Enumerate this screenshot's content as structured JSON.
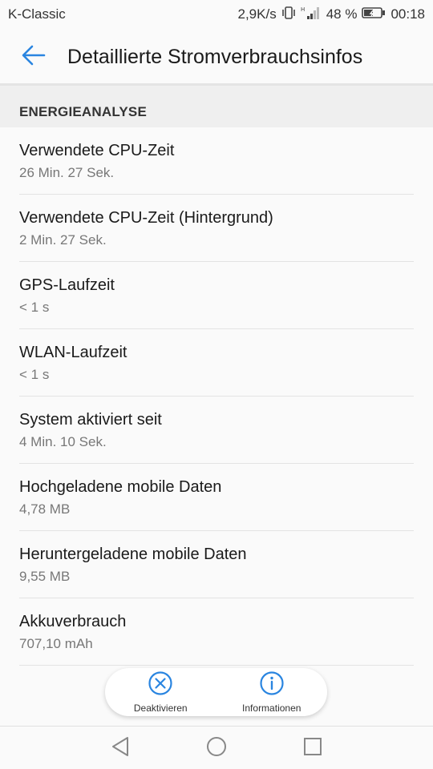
{
  "status_bar": {
    "carrier": "K-Classic",
    "speed": "2,9K/s",
    "battery": "48 %",
    "time": "00:18",
    "icons": [
      "vibrate-icon",
      "signal-icon",
      "battery-charging-icon"
    ]
  },
  "header": {
    "title": "Detaillierte Stromverbrauchsinfos",
    "back_icon": "arrow-left-icon",
    "accent_color": "#2a85e0"
  },
  "section": {
    "title": "ENERGIEANALYSE"
  },
  "items": [
    {
      "title": "Verwendete CPU-Zeit",
      "value": "26 Min. 27 Sek."
    },
    {
      "title": "Verwendete CPU-Zeit (Hintergrund)",
      "value": "2 Min. 27 Sek."
    },
    {
      "title": "GPS-Laufzeit",
      "value": "< 1 s"
    },
    {
      "title": "WLAN-Laufzeit",
      "value": "< 1 s"
    },
    {
      "title": "System aktiviert seit",
      "value": "4 Min. 10 Sek."
    },
    {
      "title": "Hochgeladene mobile Daten",
      "value": "4,78 MB"
    },
    {
      "title": "Heruntergeladene mobile Daten",
      "value": "9,55 MB"
    },
    {
      "title": "Akkuverbrauch",
      "value": "707,10 mAh"
    }
  ],
  "actions": {
    "deactivate_label": "Deaktivieren",
    "deactivate_icon": "circle-x-icon",
    "info_label": "Informationen",
    "info_icon": "circle-info-icon"
  },
  "navbar": {
    "icons": [
      "back-triangle-icon",
      "home-circle-icon",
      "recents-square-icon"
    ]
  }
}
